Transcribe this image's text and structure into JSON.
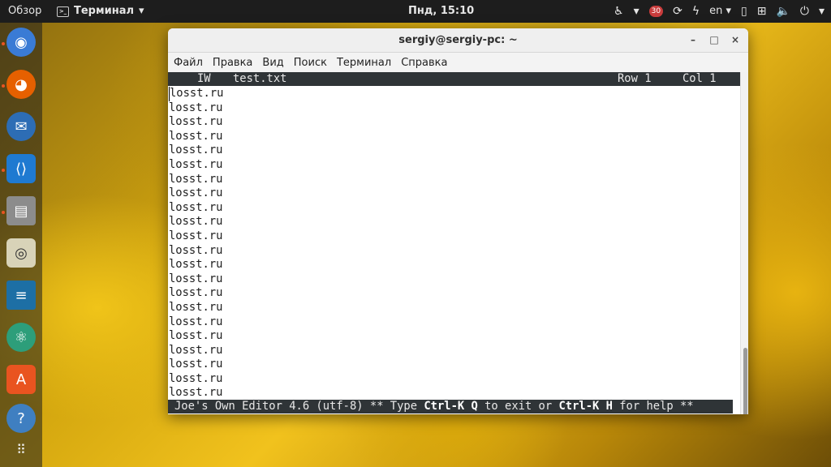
{
  "topbar": {
    "overview": "Обзор",
    "app_name": "Терминал",
    "app_arrow": "▾",
    "clock": "Пнд, 15:10",
    "accessibility_icon": "accessibility-icon",
    "notifications_count": "30",
    "language": "en",
    "language_arrow": "▾",
    "tray_arrow": "▾"
  },
  "window": {
    "title": "sergiy@sergiy-pc: ~",
    "minimize": "–",
    "maximize": "□",
    "close": "×"
  },
  "menu": {
    "file": "Файл",
    "edit": "Правка",
    "view": "Вид",
    "search": "Поиск",
    "terminal": "Терминал",
    "help": "Справка"
  },
  "editor": {
    "mode": "IW",
    "filename": "test.txt",
    "row": "Row 1",
    "col": "Col 1",
    "lines": [
      "losst.ru",
      "losst.ru",
      "losst.ru",
      "losst.ru",
      "losst.ru",
      "losst.ru",
      "losst.ru",
      "losst.ru",
      "losst.ru",
      "losst.ru",
      "losst.ru",
      "losst.ru",
      "losst.ru",
      "losst.ru",
      "losst.ru",
      "losst.ru",
      "losst.ru",
      "losst.ru",
      "losst.ru",
      "losst.ru",
      "losst.ru",
      "losst.ru"
    ],
    "help_pre": "Joe's Own Editor 4.6 (utf-8) ** Type ",
    "help_key1": "Ctrl-K Q",
    "help_mid": " to exit or ",
    "help_key2": "Ctrl-K H",
    "help_post": " for help **"
  },
  "dock": {
    "icons": [
      "chromium-icon",
      "firefox-icon",
      "thunderbird-icon",
      "vscode-icon",
      "files-icon",
      "speaker-icon",
      "writer-icon",
      "atom-icon",
      "software-center-icon",
      "help-icon",
      "show-apps-icon"
    ]
  }
}
